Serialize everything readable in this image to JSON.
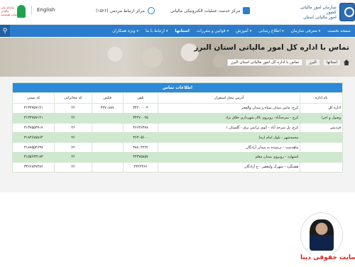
{
  "header": {
    "org_name": "سازمان امور مالیاتی کشور\nامور مالیاتی استان",
    "service_center": "مرکز خدمت عملیات الکترونیکی مالیاتی",
    "call_center": "مرکز ارتباط مردمی (۱۵۲۶)",
    "language": "English",
    "left_logo_text": "سامانه ملی\nمالیاتی\nدولت هوشمند"
  },
  "nav": {
    "items": [
      {
        "label": "صفحه نخست",
        "caret": false,
        "active": false
      },
      {
        "label": "معرفی سازمان",
        "caret": true,
        "active": false
      },
      {
        "label": "اطلاع رسانی",
        "caret": true,
        "active": false
      },
      {
        "label": "آموزش",
        "caret": true,
        "active": false
      },
      {
        "label": "قوانین و مقررات",
        "caret": true,
        "active": false
      },
      {
        "label": "استانها",
        "caret": false,
        "active": true
      },
      {
        "label": "ارتباط با ما",
        "caret": true,
        "active": false
      },
      {
        "label": "ویژه همکاران",
        "caret": true,
        "active": false
      }
    ],
    "search_icon": "search-icon"
  },
  "hero": {
    "title": "تماس با اداره کل امور مالیاتی استان البرز",
    "breadcrumb": [
      "استانها",
      "البرز",
      "تماس با اداره کل امور مالیاتی استان البرز"
    ]
  },
  "table": {
    "caption": "اطلاعات تماس",
    "columns": [
      "نام اداره",
      "آدرس محل استقرار",
      "تلفن",
      "فکس",
      "کد مخابراتی",
      "کد پستی"
    ],
    "rows": [
      [
        "اداره کل",
        "کرج- مابین میدان سپاه و میدان والفجر",
        "۳۴۲۰۰۰۰۴",
        "۳۲۷۰۸۸۹",
        "۲۶",
        "۳۱۳۳۷۵۷۱۴۱"
      ],
      [
        "وصول و اجرا",
        "کرج - سرحدآباد- روبروی تالار شهرداری خلاق نژاد",
        "۳۴۴۷۰۰۲۵",
        "",
        "۲۶",
        "۳۱۳۳۷۵۷۱۴۱"
      ],
      [
        "فردیس",
        "کرج، پل سرحد آباد - اتوی ترابس برق - گلستان ۱",
        "۳۶۶۳۶۳۷۸",
        "",
        "۲۶",
        "۳۱۳۷۵۵۳۷۱۷"
      ],
      [
        "",
        "محمدشهر - بلوار امام (ره)",
        "۳۶۳۰۵۶۰۰",
        "",
        "۲۶",
        "۳۱۸۴۶۷۵۸۶۴"
      ],
      [
        "",
        "ماهدشت - نرسیده به میدان آزادگان",
        "۳۸۸۰۴۲۲۲",
        "",
        "۲۶",
        "۳۱۸۷۵۵۴۶۳۸"
      ],
      [
        "",
        "اشتهارد - روبروی میدان معلم",
        "۴۴۴۷۵۸۵۷",
        "",
        "۲۶",
        "۳۱۵۵۶۳۳۱۸۳"
      ],
      [
        "",
        "هشتگرد - شهرک ولیعصر - خ آزادگان",
        "۴۴۲۲۳۶۶",
        "",
        "۲۶",
        "۳۳۶۶۸۳۷۴۷۶"
      ]
    ]
  },
  "watermark": {
    "text": "سایت حقوقی دینا"
  }
}
